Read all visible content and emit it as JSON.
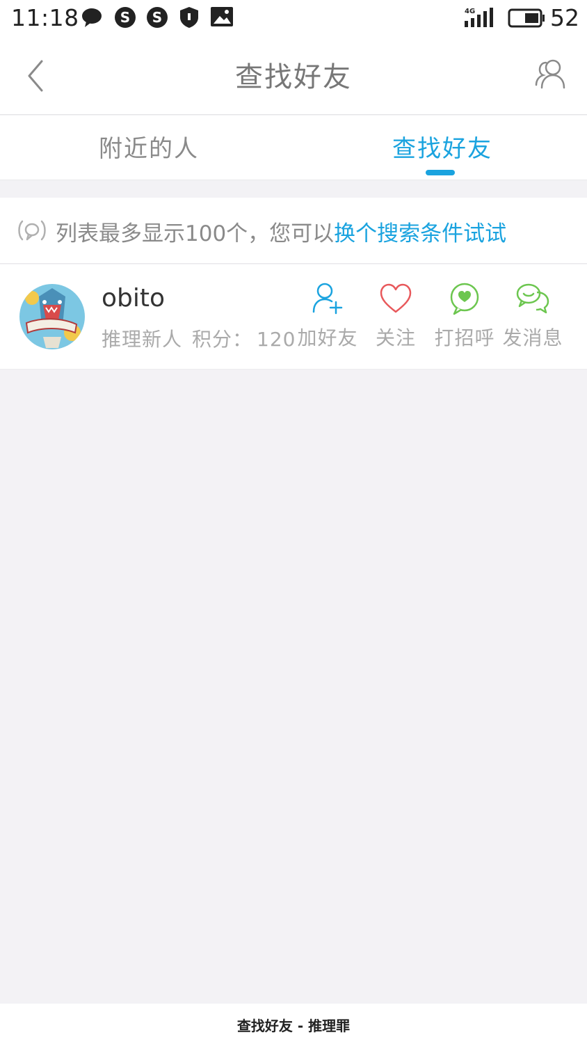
{
  "status_bar": {
    "time": "11:18",
    "network": "4G",
    "battery": "52",
    "icons": [
      "chat-bubble-icon",
      "app-s-icon",
      "app-s-icon",
      "shield-icon",
      "image-icon"
    ]
  },
  "header": {
    "title": "查找好友",
    "back_icon": "chevron-left-icon",
    "right_icon": "contacts-icon"
  },
  "tabs": [
    {
      "label": "附近的人",
      "active": false
    },
    {
      "label": "查找好友",
      "active": true
    }
  ],
  "notice": {
    "icon": "broadcast-icon",
    "text": "列表最多显示100个，您可以",
    "link": "换个搜索条件试试"
  },
  "users": [
    {
      "name": "obito",
      "rank": "推理新人",
      "score_label": "积分：",
      "score": "120",
      "actions": [
        {
          "label": "加好友",
          "icon": "add-user-icon"
        },
        {
          "label": "关注",
          "icon": "heart-icon"
        },
        {
          "label": "打招呼",
          "icon": "greet-bubble-icon"
        },
        {
          "label": "发消息",
          "icon": "message-bubbles-icon"
        }
      ]
    }
  ],
  "footer": {
    "text": "查找好友 - 推理罪"
  },
  "colors": {
    "accent": "#1aa3df",
    "follow": "#e8585b",
    "greet": "#6cc64f",
    "background": "#f3f2f5"
  }
}
